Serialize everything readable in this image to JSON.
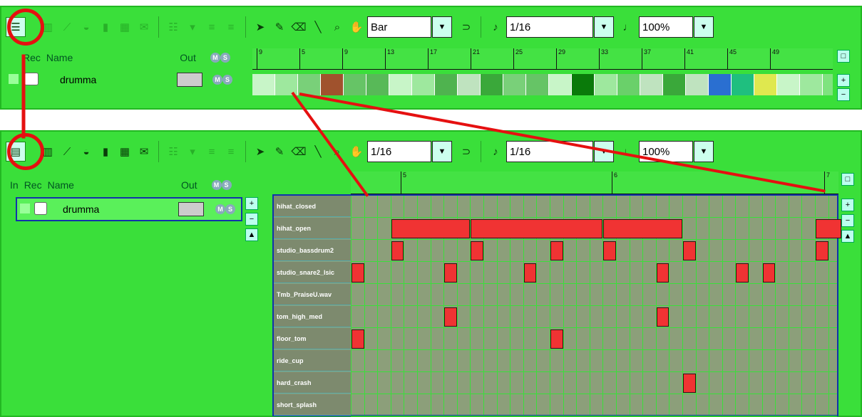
{
  "top": {
    "snap_value": "Bar",
    "quant_value": "1/16",
    "zoom_value": "100%",
    "header": {
      "rec": "Rec",
      "name": "Name",
      "out": "Out",
      "ms": "M S"
    },
    "ruler_ticks": [
      "9",
      "5",
      "9",
      "13",
      "17",
      "21",
      "25",
      "29",
      "33",
      "37",
      "41",
      "45",
      "49"
    ],
    "track_name": "drumma"
  },
  "bottom": {
    "snap_value": "1/16",
    "quant_value": "1/16",
    "zoom_value": "100%",
    "header": {
      "in": "In",
      "rec": "Rec",
      "name": "Name",
      "out": "Out",
      "ms": "M S"
    },
    "ruler_ticks": [
      "5",
      "6",
      "7"
    ],
    "track_name": "drumma",
    "rows": [
      "hihat_closed",
      "hihat_open",
      "studio_bassdrum2",
      "studio_snare2_lsic",
      "Tmb_PraiseU.wav",
      "tom_high_med",
      "floor_tom",
      "ride_cup",
      "hard_crash",
      "short_splash"
    ]
  },
  "icons": {
    "menu": "hamburger-menu-icon",
    "pointer": "pointer-icon",
    "pencil": "pencil-icon",
    "eraser": "eraser-icon",
    "line": "line-tool-icon",
    "zoom": "magnifier-icon",
    "hand": "hand-icon"
  },
  "colors": {
    "panel": "#3adf3a",
    "note": "#f03333",
    "annotation": "#e51010",
    "grid": "#8c9f7a"
  }
}
